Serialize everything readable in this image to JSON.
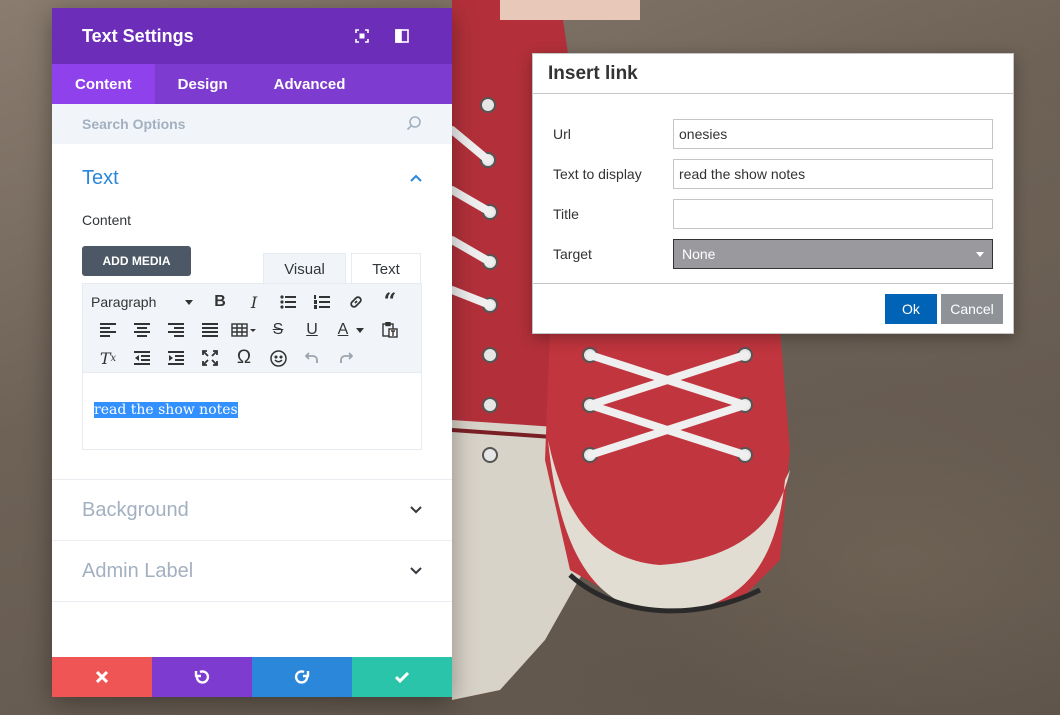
{
  "panel": {
    "title": "Text Settings",
    "tabs": [
      {
        "label": "Content",
        "active": true
      },
      {
        "label": "Design",
        "active": false
      },
      {
        "label": "Advanced",
        "active": false
      }
    ],
    "search_placeholder": "Search Options",
    "section_text": {
      "title": "Text",
      "content_label": "Content",
      "add_media_label": "ADD MEDIA",
      "editor_tabs": [
        "Visual",
        "Text"
      ],
      "format_select": "Paragraph",
      "editor_content": "read the show notes"
    },
    "section_background": "Background",
    "section_admin_label": "Admin Label",
    "colors": {
      "header": "#6c2eb9",
      "tabs": "#7e3bd0",
      "active_tab": "#8f42ec",
      "accent_blue": "#2b87da",
      "cancel": "#ef5555",
      "save": "#29c4a9"
    }
  },
  "dialog": {
    "title": "Insert link",
    "fields": {
      "url": {
        "label": "Url",
        "value": "onesies"
      },
      "text_to_display": {
        "label": "Text to display",
        "value": "read the show notes"
      },
      "title": {
        "label": "Title",
        "value": ""
      },
      "target": {
        "label": "Target",
        "value": "None"
      }
    },
    "ok_label": "Ok",
    "cancel_label": "Cancel"
  }
}
